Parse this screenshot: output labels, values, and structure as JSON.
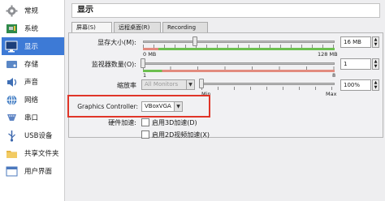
{
  "sidebar": {
    "items": [
      {
        "label": "常规",
        "icon": "gear-icon"
      },
      {
        "label": "系统",
        "icon": "motherboard-icon"
      },
      {
        "label": "显示",
        "icon": "monitor-icon"
      },
      {
        "label": "存储",
        "icon": "disk-icon"
      },
      {
        "label": "声音",
        "icon": "speaker-icon"
      },
      {
        "label": "网络",
        "icon": "network-icon"
      },
      {
        "label": "串口",
        "icon": "serial-port-icon"
      },
      {
        "label": "USB设备",
        "icon": "usb-icon"
      },
      {
        "label": "共享文件夹",
        "icon": "folder-icon"
      },
      {
        "label": "用户界面",
        "icon": "window-icon"
      }
    ],
    "selected_index": 2
  },
  "header": {
    "title": "显示"
  },
  "tabs": [
    {
      "label": "屏幕(S)"
    },
    {
      "label": "远程桌面(R)"
    },
    {
      "label": "Recording"
    }
  ],
  "video_memory": {
    "label": "显存大小(M):",
    "min": "0 MB",
    "max": "128 MB",
    "value": "16 MB",
    "fraction": 0.27
  },
  "monitor_count": {
    "label": "监视器数量(O):",
    "min": "1",
    "max": "8",
    "value": "1",
    "fraction": 0.0
  },
  "scale_factor": {
    "label": "缩放率",
    "monitors_select": "All Monitors",
    "min": "Min",
    "max": "Max",
    "value": "100%",
    "fraction": 0.0
  },
  "graphics_controller": {
    "label": "Graphics Controller:",
    "value": "VBoxVGA"
  },
  "acceleration": {
    "label": "硬件加速:",
    "option_3d": "启用3D加速(D)",
    "option_2d": "启用2D视频加速(X)"
  },
  "colors": {
    "selection": "#3d7ad6",
    "highlight_frame": "#e03528",
    "good_range": "#6cbf4f",
    "bad_range": "#e28b7f"
  }
}
